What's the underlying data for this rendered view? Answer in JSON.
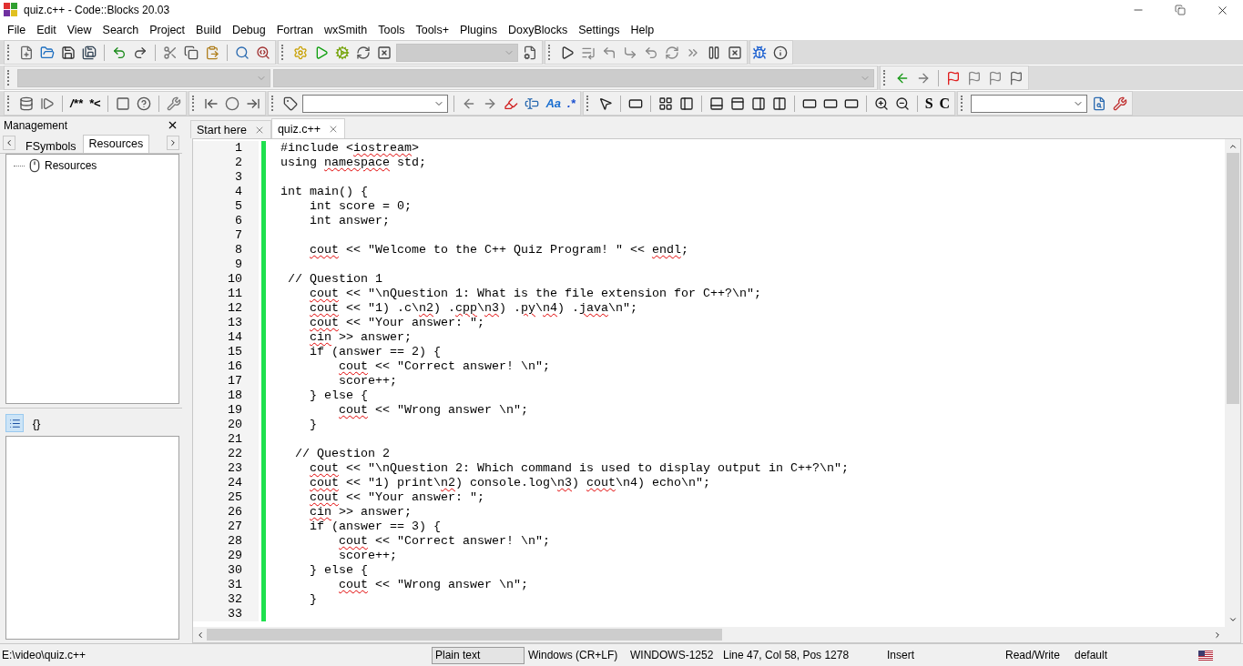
{
  "window": {
    "title": "quiz.c++ - Code::Blocks 20.03"
  },
  "menu": [
    "File",
    "Edit",
    "View",
    "Search",
    "Project",
    "Build",
    "Debug",
    "Fortran",
    "wxSmith",
    "Tools",
    "Tools+",
    "Plugins",
    "DoxyBlocks",
    "Settings",
    "Help"
  ],
  "toolbar_glyphs": {
    "doxy_block_comment": "/**",
    "doxy_line_comment": "*<",
    "match_case": "Aa",
    "regex": ".*",
    "bold_s": "S",
    "bold_c": "C"
  },
  "management": {
    "title": "Management",
    "tabs": [
      {
        "label": "FSymbols",
        "selected": false
      },
      {
        "label": "Resources",
        "selected": true
      }
    ],
    "tree": [
      {
        "label": "Resources"
      }
    ],
    "lower_tabs": [
      {
        "kind": "list",
        "selected": true
      },
      {
        "kind": "braces",
        "label": "{}",
        "selected": false
      }
    ]
  },
  "editor": {
    "tabs": [
      {
        "label": "Start here",
        "selected": false
      },
      {
        "label": "quiz.c++",
        "selected": true
      }
    ],
    "lines": [
      {
        "n": "1",
        "parts": [
          {
            "text": "#include <",
            "flagged": false
          },
          {
            "text": "iostream",
            "flagged": true
          },
          {
            "text": ">",
            "flagged": false
          }
        ]
      },
      {
        "n": "2",
        "parts": [
          {
            "text": "using ",
            "flagged": false
          },
          {
            "text": "namespace",
            "flagged": true
          },
          {
            "text": " std;",
            "flagged": false
          }
        ]
      },
      {
        "n": "3"
      },
      {
        "n": "4",
        "parts": [
          {
            "text": "int main() {",
            "flagged": false
          }
        ]
      },
      {
        "n": "5",
        "parts": [
          {
            "text": "    int score = 0;",
            "flagged": false
          }
        ]
      },
      {
        "n": "6",
        "parts": [
          {
            "text": "    int answer;",
            "flagged": false
          }
        ]
      },
      {
        "n": "7"
      },
      {
        "n": "8",
        "parts": [
          {
            "text": "    cout",
            "flagged": true
          },
          {
            "text": " << \"Welcome to the C++ Quiz Program! \" << ",
            "flagged": false
          },
          {
            "text": "endl",
            "flagged": true
          },
          {
            "text": ";",
            "flagged": false
          }
        ]
      },
      {
        "n": "9"
      },
      {
        "n": "10",
        "parts": [
          {
            "text": " // Question 1",
            "flagged": false
          }
        ]
      },
      {
        "n": "11",
        "parts": [
          {
            "text": "    cout",
            "flagged": true
          },
          {
            "text": " << \"\\nQuestion 1: What is the file extension for C++?\\n\";",
            "flagged": false
          }
        ]
      },
      {
        "n": "12",
        "parts": [
          {
            "text": "    cout",
            "flagged": true
          },
          {
            "text": " << \"1) .c\\",
            "flagged": false
          },
          {
            "text": "n2",
            "flagged": true
          },
          {
            "text": ") .",
            "flagged": false
          },
          {
            "text": "cpp",
            "flagged": true
          },
          {
            "text": "\\",
            "flagged": false
          },
          {
            "text": "n3",
            "flagged": true
          },
          {
            "text": ") .",
            "flagged": false
          },
          {
            "text": "py",
            "flagged": true
          },
          {
            "text": "\\",
            "flagged": false
          },
          {
            "text": "n4",
            "flagged": true
          },
          {
            "text": ") .",
            "flagged": false
          },
          {
            "text": "java",
            "flagged": true
          },
          {
            "text": "\\n\";",
            "flagged": false
          }
        ]
      },
      {
        "n": "13",
        "parts": [
          {
            "text": "    cout",
            "flagged": true
          },
          {
            "text": " << \"Your answer: \";",
            "flagged": false
          }
        ]
      },
      {
        "n": "14",
        "parts": [
          {
            "text": "    cin",
            "flagged": true
          },
          {
            "text": " >> answer;",
            "flagged": false
          }
        ]
      },
      {
        "n": "15",
        "parts": [
          {
            "text": "    if (answer == 2) {",
            "flagged": false
          }
        ]
      },
      {
        "n": "16",
        "parts": [
          {
            "text": "        cout",
            "flagged": true
          },
          {
            "text": " << \"Correct answer! \\n\";",
            "flagged": false
          }
        ]
      },
      {
        "n": "17",
        "parts": [
          {
            "text": "        score++;",
            "flagged": false
          }
        ]
      },
      {
        "n": "18",
        "parts": [
          {
            "text": "    } else {",
            "flagged": false
          }
        ]
      },
      {
        "n": "19",
        "parts": [
          {
            "text": "        cout",
            "flagged": true
          },
          {
            "text": " << \"Wrong answer \\n\";",
            "flagged": false
          }
        ]
      },
      {
        "n": "20",
        "parts": [
          {
            "text": "    }",
            "flagged": false
          }
        ]
      },
      {
        "n": "21"
      },
      {
        "n": "22",
        "parts": [
          {
            "text": "  // Question 2",
            "flagged": false
          }
        ]
      },
      {
        "n": "23",
        "parts": [
          {
            "text": "    cout",
            "flagged": true
          },
          {
            "text": " << \"\\nQuestion 2: Which command is used to display output in C++?\\n\";",
            "flagged": false
          }
        ]
      },
      {
        "n": "24",
        "parts": [
          {
            "text": "    cout",
            "flagged": true
          },
          {
            "text": " << \"1) print\\",
            "flagged": false
          },
          {
            "text": "n2",
            "flagged": true
          },
          {
            "text": ") console.log\\",
            "flagged": false
          },
          {
            "text": "n3",
            "flagged": true
          },
          {
            "text": ") ",
            "flagged": false
          },
          {
            "text": "cout",
            "flagged": true
          },
          {
            "text": "\\n4) echo\\n\";",
            "flagged": false
          }
        ]
      },
      {
        "n": "25",
        "parts": [
          {
            "text": "    cout",
            "flagged": true
          },
          {
            "text": " << \"Your answer: \";",
            "flagged": false
          }
        ]
      },
      {
        "n": "26",
        "parts": [
          {
            "text": "    cin",
            "flagged": true
          },
          {
            "text": " >> answer;",
            "flagged": false
          }
        ]
      },
      {
        "n": "27",
        "parts": [
          {
            "text": "    if (answer == 3) {",
            "flagged": false
          }
        ]
      },
      {
        "n": "28",
        "parts": [
          {
            "text": "        cout",
            "flagged": true
          },
          {
            "text": " << \"Correct answer! \\n\";",
            "flagged": false
          }
        ]
      },
      {
        "n": "29",
        "parts": [
          {
            "text": "        score++;",
            "flagged": false
          }
        ]
      },
      {
        "n": "30",
        "parts": [
          {
            "text": "    } else {",
            "flagged": false
          }
        ]
      },
      {
        "n": "31",
        "parts": [
          {
            "text": "        cout",
            "flagged": true
          },
          {
            "text": " << \"Wrong answer \\n\";",
            "flagged": false
          }
        ]
      },
      {
        "n": "32",
        "parts": [
          {
            "text": "    }",
            "flagged": false
          }
        ]
      },
      {
        "n": "33"
      }
    ]
  },
  "status_bar": {
    "path": "E:\\video\\quiz.c++",
    "fields": [
      {
        "text": "Plain text",
        "highlighted": true
      },
      {
        "text": "Windows (CR+LF)",
        "highlighted": false
      },
      {
        "text": "WINDOWS-1252",
        "highlighted": false
      },
      {
        "text": "Line 47, Col 58, Pos 1278",
        "highlighted": false
      },
      {
        "text": "Insert",
        "highlighted": false
      },
      {
        "text": "Read/Write",
        "highlighted": false
      },
      {
        "text": "default",
        "highlighted": false
      }
    ]
  }
}
